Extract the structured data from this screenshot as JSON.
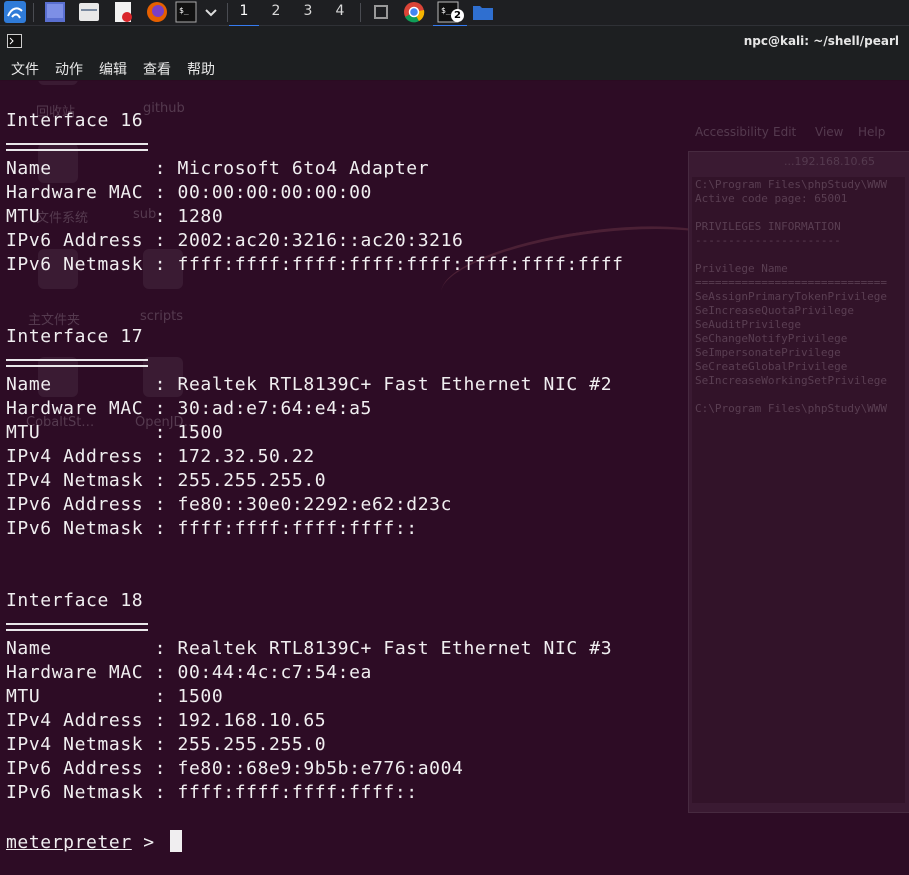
{
  "window": {
    "title": "npc@kali: ~/shell/pearl"
  },
  "menu": [
    "文件",
    "动作",
    "编辑",
    "查看",
    "帮助"
  ],
  "workspaces": [
    "1",
    "2",
    "3",
    "4"
  ],
  "terminal_badge": "2",
  "background": {
    "desktop_labels": [
      "回收站",
      "github",
      "文件系统",
      "sub",
      "主文件夹",
      "scripts",
      "CobaltSt…",
      "OpenJD…"
    ],
    "window_menu": [
      "Accessibility",
      "Edit",
      "View",
      "Help"
    ],
    "window_tab": "...192.168.10.65",
    "lines": [
      "C:\\Program Files\\phpStudy\\WWW",
      "Active code page: 65001",
      "",
      "PRIVILEGES INFORMATION",
      "----------------------",
      "",
      "Privilege Name",
      "=============================",
      "SeAssignPrimaryTokenPrivilege",
      "SeIncreaseQuotaPrivilege",
      "SeAuditPrivilege",
      "SeChangeNotifyPrivilege",
      "SeImpersonatePrivilege",
      "SeCreateGlobalPrivilege",
      "SeIncreaseWorkingSetPrivilege",
      "",
      "C:\\Program Files\\phpStudy\\WWW"
    ]
  },
  "interfaces": [
    {
      "header": "Interface 16",
      "rows": [
        "Name         : Microsoft 6to4 Adapter",
        "Hardware MAC : 00:00:00:00:00:00",
        "MTU          : 1280",
        "IPv6 Address : 2002:ac20:3216::ac20:3216",
        "IPv6 Netmask : ffff:ffff:ffff:ffff:ffff:ffff:ffff:ffff"
      ]
    },
    {
      "header": "Interface 17",
      "rows": [
        "Name         : Realtek RTL8139C+ Fast Ethernet NIC #2",
        "Hardware MAC : 30:ad:e7:64:e4:a5",
        "MTU          : 1500",
        "IPv4 Address : 172.32.50.22",
        "IPv4 Netmask : 255.255.255.0",
        "IPv6 Address : fe80::30e0:2292:e62:d23c",
        "IPv6 Netmask : ffff:ffff:ffff:ffff::"
      ]
    },
    {
      "header": "Interface 18",
      "rows": [
        "Name         : Realtek RTL8139C+ Fast Ethernet NIC #3",
        "Hardware MAC : 00:44:4c:c7:54:ea",
        "MTU          : 1500",
        "IPv4 Address : 192.168.10.65",
        "IPv4 Netmask : 255.255.255.0",
        "IPv6 Address : fe80::68e9:9b5b:e776:a004",
        "IPv6 Netmask : ffff:ffff:ffff:ffff::"
      ]
    }
  ],
  "prompt": {
    "label": "meterpreter",
    "symbol": " > "
  }
}
